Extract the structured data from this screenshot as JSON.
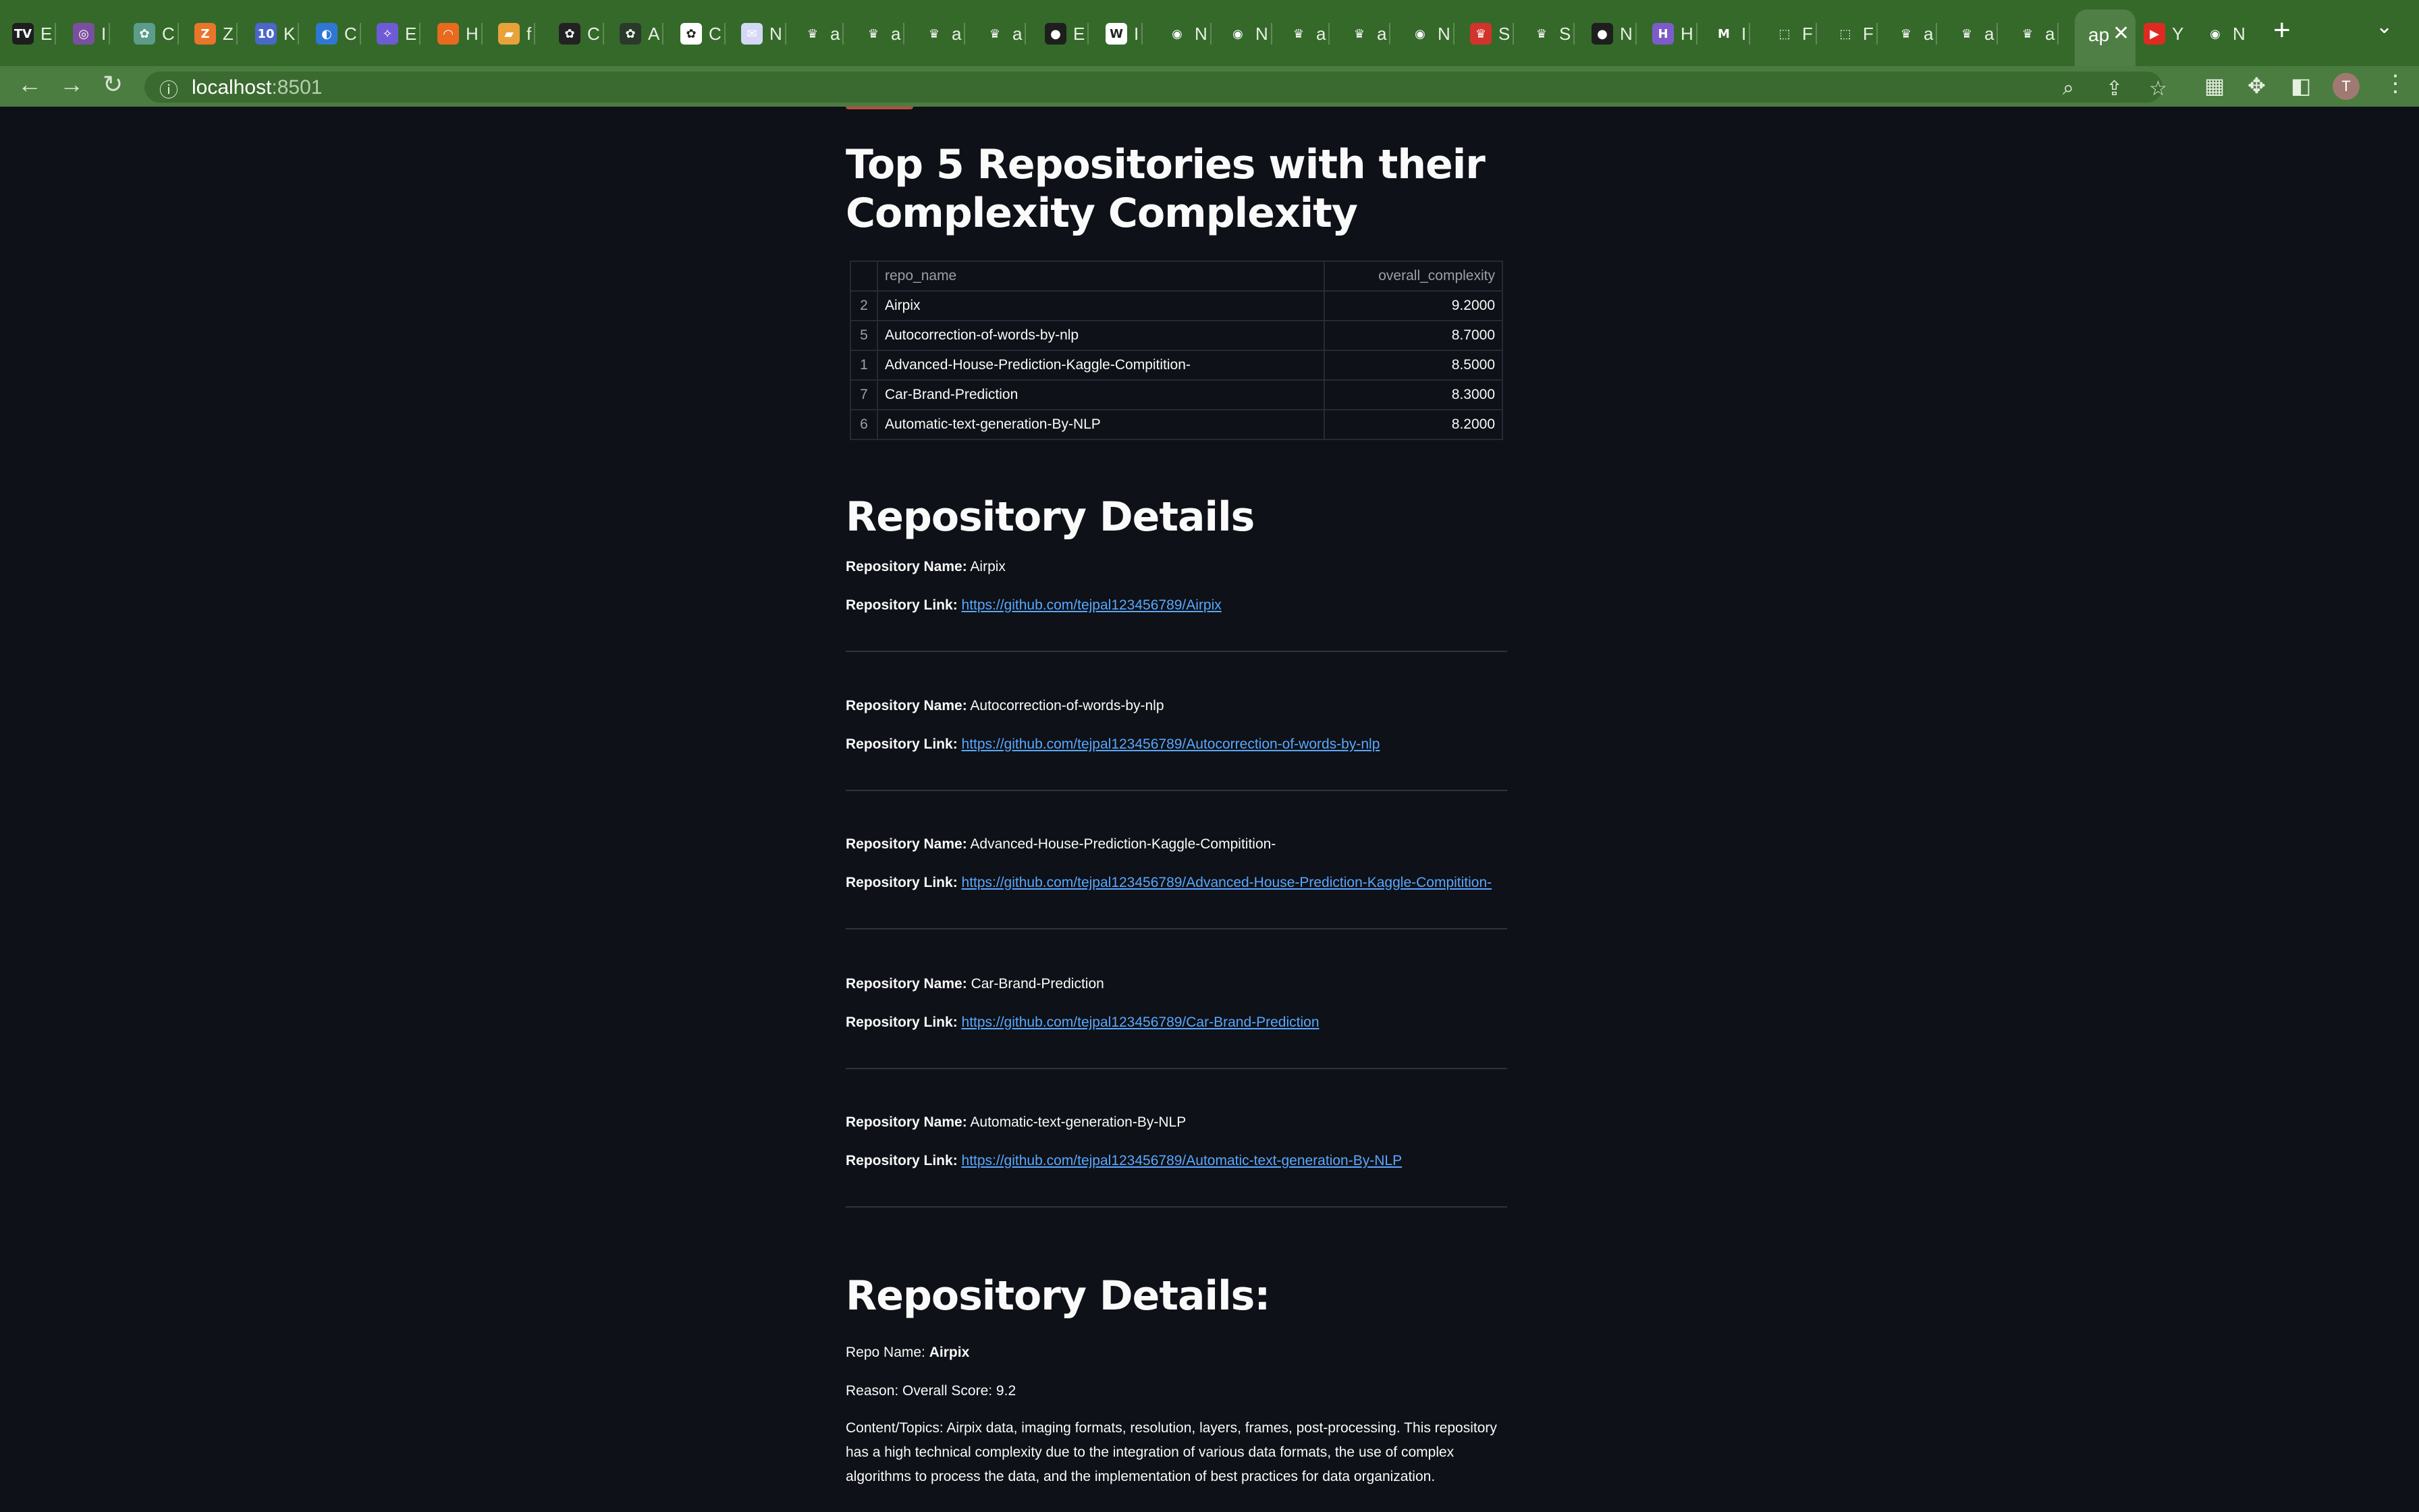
{
  "browser": {
    "tabs": [
      {
        "letter": "E",
        "favicon": "TV",
        "color": "#1e1e1e"
      },
      {
        "letter": "I",
        "favicon": "◎",
        "color": "#7b4fa0"
      },
      {
        "letter": "C",
        "favicon": "✿",
        "color": "#5c9c8a"
      },
      {
        "letter": "Z",
        "favicon": "Z",
        "color": "#e9752a"
      },
      {
        "letter": "K",
        "favicon": "10",
        "color": "#4a67c9"
      },
      {
        "letter": "C",
        "favicon": "◐",
        "color": "#2f77d4"
      },
      {
        "letter": "E",
        "favicon": "✧",
        "color": "#6e5bd6"
      },
      {
        "letter": "H",
        "favicon": "◠",
        "color": "#e86a1e"
      },
      {
        "letter": "f",
        "favicon": "▰",
        "color": "#e8a23a"
      },
      {
        "letter": "C",
        "favicon": "✿",
        "color": "#222222"
      },
      {
        "letter": "A",
        "favicon": "✿",
        "color": "#2a3a2a"
      },
      {
        "letter": "C",
        "favicon": "✿",
        "color": "#ffffff"
      },
      {
        "letter": "N",
        "favicon": "✉",
        "color": "#d4d8f4"
      },
      {
        "letter": "a",
        "favicon": "♛",
        "color": "#35692a"
      },
      {
        "letter": "a",
        "favicon": "♛",
        "color": "#35692a"
      },
      {
        "letter": "a",
        "favicon": "♛",
        "color": "#35692a"
      },
      {
        "letter": "a",
        "favicon": "♛",
        "color": "#35692a"
      },
      {
        "letter": "E",
        "favicon": "●",
        "color": "#1e1e1e"
      },
      {
        "letter": "I",
        "favicon": "W",
        "color": "#ffffff"
      },
      {
        "letter": "N",
        "favicon": "◉",
        "color": "#35692a"
      },
      {
        "letter": "N",
        "favicon": "◉",
        "color": "#35692a"
      },
      {
        "letter": "a",
        "favicon": "♛",
        "color": "#35692a"
      },
      {
        "letter": "a",
        "favicon": "♛",
        "color": "#35692a"
      },
      {
        "letter": "N",
        "favicon": "◉",
        "color": "#35692a"
      },
      {
        "letter": "S",
        "favicon": "♛",
        "color": "#d2332b"
      },
      {
        "letter": "S",
        "favicon": "♛",
        "color": "#35692a"
      },
      {
        "letter": "N",
        "favicon": "●",
        "color": "#1e1e1e"
      },
      {
        "letter": "H",
        "favicon": "H",
        "color": "#7d5cc9"
      },
      {
        "letter": "I",
        "favicon": "M",
        "color": "#35692a"
      },
      {
        "letter": "F",
        "favicon": "⬚",
        "color": "#35692a"
      },
      {
        "letter": "F",
        "favicon": "⬚",
        "color": "#35692a"
      },
      {
        "letter": "a",
        "favicon": "♛",
        "color": "#35692a"
      },
      {
        "letter": "a",
        "favicon": "♛",
        "color": "#35692a"
      },
      {
        "letter": "a",
        "favicon": "♛",
        "color": "#35692a"
      }
    ],
    "active_tab": {
      "letter": "ap",
      "close": "✕"
    },
    "after_tabs": [
      {
        "letter": "Y",
        "favicon": "▶",
        "color": "#e02a21"
      },
      {
        "letter": "N",
        "favicon": "◉",
        "color": "#35692a"
      }
    ],
    "new_tab": "+",
    "tab_menu": "⌄",
    "url_host": "localhost",
    "url_port": ":8501",
    "avatar_letter": "T",
    "icons": [
      "back-arrow-icon",
      "forward-arrow-icon",
      "reload-icon",
      "info-icon",
      "zoom-icon",
      "share-icon",
      "star-icon",
      "qr-icon",
      "extensions-icon",
      "sidepanel-icon",
      "menu-icon"
    ]
  },
  "page": {
    "title": "Top 5 Repositories with their Complexity Complexity",
    "table": {
      "columns": [
        "repo_name",
        "overall_complexity"
      ],
      "rows": [
        {
          "idx": "2",
          "repo_name": "Airpix",
          "overall_complexity": "9.2000"
        },
        {
          "idx": "5",
          "repo_name": "Autocorrection-of-words-by-nlp",
          "overall_complexity": "8.7000"
        },
        {
          "idx": "1",
          "repo_name": "Advanced-House-Prediction-Kaggle-Compitition-",
          "overall_complexity": "8.5000"
        },
        {
          "idx": "7",
          "repo_name": "Car-Brand-Prediction",
          "overall_complexity": "8.3000"
        },
        {
          "idx": "6",
          "repo_name": "Automatic-text-generation-By-NLP",
          "overall_complexity": "8.2000"
        }
      ]
    },
    "details_heading": "Repository Details",
    "name_label": "Repository Name:",
    "link_label": "Repository Link:",
    "repos": [
      {
        "name": "Airpix",
        "link": "https://github.com/tejpal123456789/Airpix"
      },
      {
        "name": "Autocorrection-of-words-by-nlp",
        "link": "https://github.com/tejpal123456789/Autocorrection-of-words-by-nlp"
      },
      {
        "name": "Advanced-House-Prediction-Kaggle-Compitition-",
        "link": "https://github.com/tejpal123456789/Advanced-House-Prediction-Kaggle-Compitition-"
      },
      {
        "name": "Car-Brand-Prediction",
        "link": "https://github.com/tejpal123456789/Car-Brand-Prediction"
      },
      {
        "name": "Automatic-text-generation-By-NLP",
        "link": "https://github.com/tejpal123456789/Automatic-text-generation-By-NLP"
      }
    ],
    "details2_heading": "Repository Details:",
    "repo_name_label": "Repo Name:",
    "repo_name_value": "Airpix",
    "reason": "Reason: Overall Score: 9.2",
    "content_topics": "Content/Topics: Airpix data, imaging formats, resolution, layers, frames, post-processing. This repository has a high technical complexity due to the integration of various data formats, the use of complex algorithms to process the data, and the implementation of best practices for data organization."
  }
}
